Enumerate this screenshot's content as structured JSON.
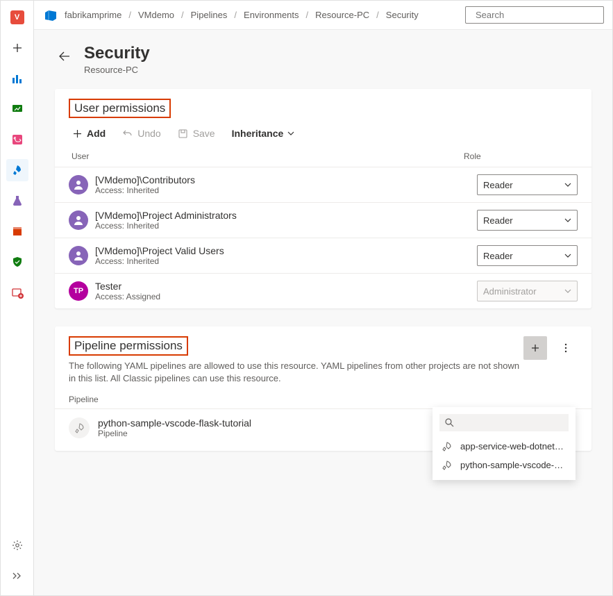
{
  "breadcrumb": [
    "fabrikamprime",
    "VMdemo",
    "Pipelines",
    "Environments",
    "Resource-PC",
    "Security"
  ],
  "search": {
    "placeholder": "Search"
  },
  "page": {
    "title": "Security",
    "subtitle": "Resource-PC"
  },
  "userPerms": {
    "title": "User permissions",
    "toolbar": {
      "add": "Add",
      "undo": "Undo",
      "save": "Save",
      "inherit": "Inheritance"
    },
    "columns": {
      "user": "User",
      "role": "Role"
    },
    "rows": [
      {
        "name": "[VMdemo]\\Contributors",
        "access": "Access: Inherited",
        "role": "Reader",
        "type": "grp",
        "disabled": false
      },
      {
        "name": "[VMdemo]\\Project Administrators",
        "access": "Access: Inherited",
        "role": "Reader",
        "type": "grp",
        "disabled": false
      },
      {
        "name": "[VMdemo]\\Project Valid Users",
        "access": "Access: Inherited",
        "role": "Reader",
        "type": "grp",
        "disabled": false
      },
      {
        "name": "Tester",
        "access": "Access: Assigned",
        "role": "Administrator",
        "type": "usr",
        "initials": "TP",
        "disabled": true
      }
    ]
  },
  "pipePerms": {
    "title": "Pipeline permissions",
    "desc": "The following YAML pipelines are allowed to use this resource. YAML pipelines from other projects are not shown in this list. All Classic pipelines can use this resource.",
    "column": "Pipeline",
    "rows": [
      {
        "name": "python-sample-vscode-flask-tutorial",
        "sub": "Pipeline"
      }
    ]
  },
  "popup": {
    "items": [
      "app-service-web-dotnet…",
      "python-sample-vscode-…"
    ]
  },
  "sidebarColors": [
    "#e74c3c",
    "",
    "#0078d4",
    "#107c10",
    "#e8467c",
    "#0078d4",
    "#8764b8",
    "#d83b01",
    "#107c10",
    "#d13438"
  ]
}
